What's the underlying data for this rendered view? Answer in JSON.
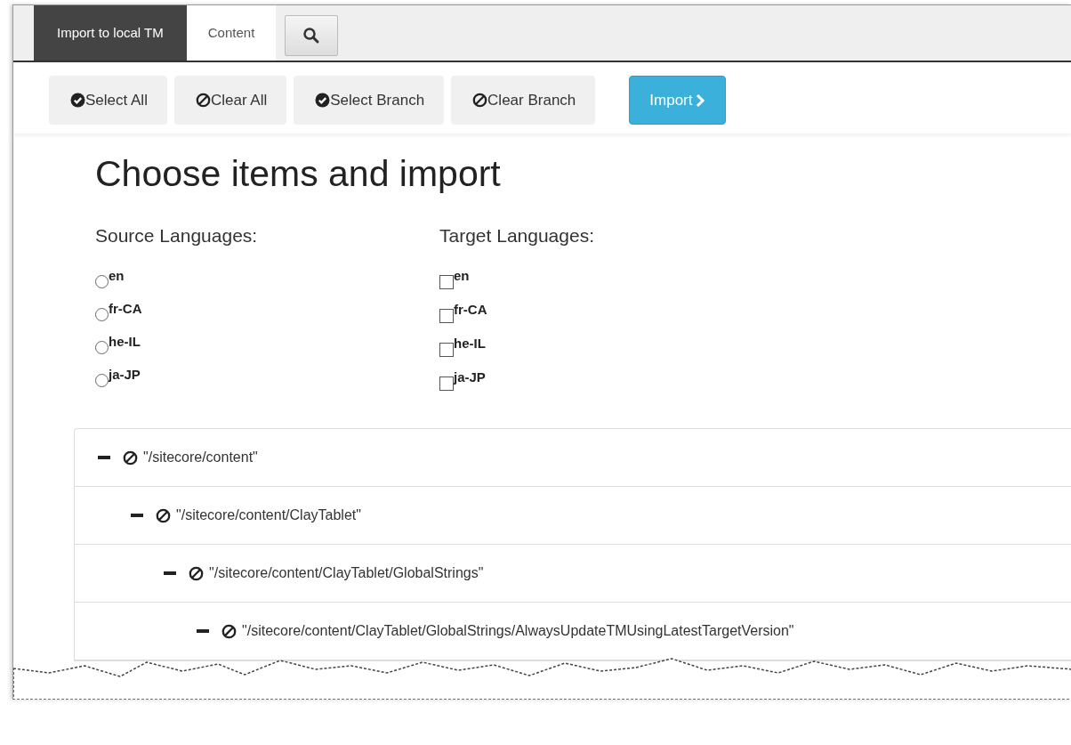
{
  "tabs": [
    {
      "label": "Import to local TM",
      "selected": true
    },
    {
      "label": "Content",
      "selected": false
    }
  ],
  "toolbar": {
    "buttons": [
      {
        "label": "Select All",
        "kind": "check"
      },
      {
        "label": "Clear All",
        "kind": "ban"
      },
      {
        "label": "Select Branch",
        "kind": "check"
      },
      {
        "label": "Clear Branch",
        "kind": "ban"
      }
    ],
    "primary": {
      "label": "Import"
    }
  },
  "heading": "Choose items and import",
  "source_languages": {
    "label": "Source Languages:",
    "options": [
      {
        "label": "en",
        "selected": false
      },
      {
        "label": "fr-CA",
        "selected": false
      },
      {
        "label": "he-IL",
        "selected": false
      },
      {
        "label": "ja-JP",
        "selected": false
      }
    ]
  },
  "target_languages": {
    "label": "Target Languages:",
    "options": [
      {
        "label": "en",
        "checked": false
      },
      {
        "label": "fr-CA",
        "checked": false
      },
      {
        "label": "he-IL",
        "checked": false
      },
      {
        "label": "ja-JP",
        "checked": false
      }
    ]
  },
  "tree": [
    {
      "label": "\"/sitecore/content\"",
      "expanded": true,
      "children": [
        {
          "label": "\"/sitecore/content/ClayTablet\"",
          "expanded": true,
          "children": [
            {
              "label": "\"/sitecore/content/ClayTablet/GlobalStrings\"",
              "expanded": true,
              "children": [
                {
                  "label": "\"/sitecore/content/ClayTablet/GlobalStrings/AlwaysUpdateTMUsingLatestTargetVersion\"",
                  "expanded": true
                }
              ]
            }
          ]
        }
      ]
    }
  ]
}
